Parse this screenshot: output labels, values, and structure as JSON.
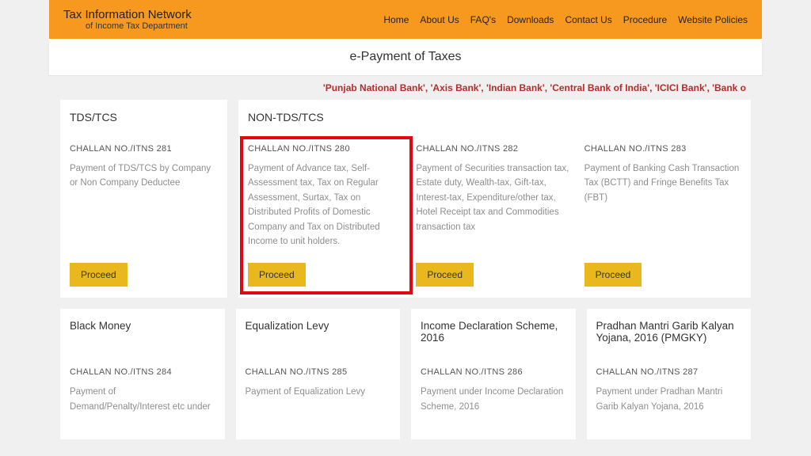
{
  "header": {
    "brand_title": "Tax Information Network",
    "brand_sub": "of Income Tax Department",
    "nav": [
      "Home",
      "About Us",
      "FAQ's",
      "Downloads",
      "Contact Us",
      "Procedure",
      "Website Policies"
    ]
  },
  "subheader": "e-Payment of Taxes",
  "marquee": "'Punjab National Bank', 'Axis Bank', 'Indian Bank', 'Central Bank of India', 'ICICI Bank', 'Bank o",
  "sections": {
    "tds": {
      "title": "TDS/TCS",
      "challan_no": "CHALLAN NO./ITNS 281",
      "desc": "Payment of TDS/TCS by Company or Non Company Deductee",
      "proceed": "Proceed"
    },
    "nontds": {
      "title": "NON-TDS/TCS",
      "items": [
        {
          "no": "CHALLAN NO./ITNS 280",
          "desc": "Payment of Advance tax, Self-Assessment tax, Tax on Regular Assessment, Surtax, Tax on Distributed Profits of Domestic Company and Tax on Distributed Income to unit holders.",
          "proceed": "Proceed"
        },
        {
          "no": "CHALLAN NO./ITNS 282",
          "desc": "Payment of Securities transaction tax, Estate duty, Wealth-tax, Gift-tax, Interest-tax, Expenditure/other tax, Hotel Receipt tax and Commodities transaction tax",
          "proceed": "Proceed"
        },
        {
          "no": "CHALLAN NO./ITNS 283",
          "desc": "Payment of Banking Cash Transaction Tax (BCTT) and Fringe Benefits Tax (FBT)",
          "proceed": "Proceed"
        }
      ]
    }
  },
  "row2": [
    {
      "title": "Black Money",
      "no": "CHALLAN NO./ITNS 284",
      "desc": "Payment of Demand/Penalty/Interest etc under"
    },
    {
      "title": "Equalization Levy",
      "no": "CHALLAN NO./ITNS 285",
      "desc": "Payment of Equalization Levy"
    },
    {
      "title": "Income Declaration Scheme, 2016",
      "no": "CHALLAN NO./ITNS 286",
      "desc": "Payment under Income Declaration Scheme, 2016"
    },
    {
      "title": "Pradhan Mantri Garib Kalyan Yojana, 2016 (PMGKY)",
      "no": "CHALLAN NO./ITNS 287",
      "desc": "Payment under Pradhan Mantri Garib Kalyan Yojana, 2016"
    }
  ]
}
